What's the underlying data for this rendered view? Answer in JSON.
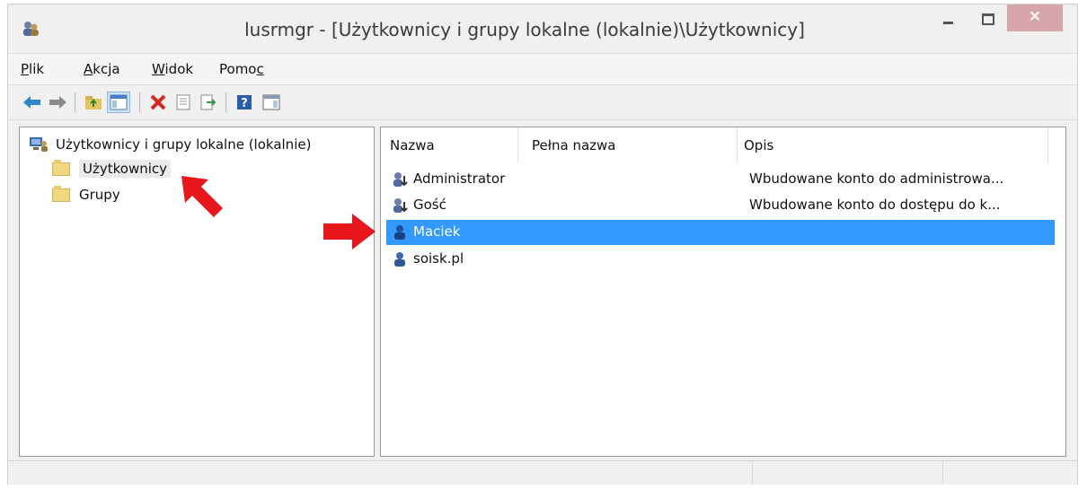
{
  "window": {
    "title": "lusrmgr - [Użytkownicy i grupy lokalne (lokalnie)\\Użytkownicy]",
    "close_label": "×"
  },
  "menu": {
    "items": [
      {
        "label": "Plik",
        "accel": "P",
        "rest": "lik"
      },
      {
        "label": "Akcja",
        "accel": "A",
        "rest": "kcja"
      },
      {
        "label": "Widok",
        "accel": "W",
        "rest": "idok"
      },
      {
        "label": "Pomoc",
        "pre": "Pomo",
        "accel": "c"
      }
    ]
  },
  "toolbar": {
    "icons": [
      "back-arrow-icon",
      "forward-arrow-icon",
      "up-folder-icon",
      "show-hide-console-tree-icon",
      "delete-icon",
      "properties-icon",
      "export-list-icon",
      "help-icon",
      "show-hide-action-pane-icon"
    ]
  },
  "tree": {
    "root": "Użytkownicy i grupy lokalne (lokalnie)",
    "children": [
      "Użytkownicy",
      "Grupy"
    ],
    "selected": "Użytkownicy"
  },
  "list": {
    "columns": [
      "Nazwa",
      "Pełna nazwa",
      "Opis"
    ],
    "rows": [
      {
        "name": "Administrator",
        "full_name": "",
        "description": "Wbudowane konto do administrowa..."
      },
      {
        "name": "Gość",
        "full_name": "",
        "description": "Wbudowane konto do dostępu do k..."
      },
      {
        "name": "Maciek",
        "full_name": "",
        "description": ""
      },
      {
        "name": "soisk.pl",
        "full_name": "",
        "description": ""
      }
    ],
    "selected_row": "Maciek"
  },
  "colors": {
    "selection": "#3399ff",
    "annotation_arrow": "#e8151b",
    "close_button": "#d7a6ab"
  }
}
